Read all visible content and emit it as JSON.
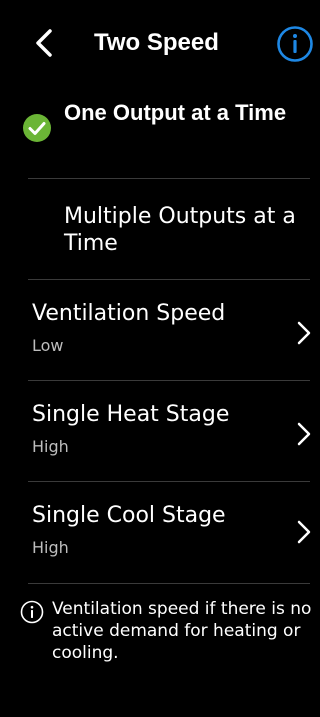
{
  "header": {
    "title": "Two Speed",
    "back_icon": "chevron-left-icon",
    "info_icon": "info-icon"
  },
  "options": [
    {
      "label": "One Output at a Time",
      "selected": true
    },
    {
      "label": "Multiple Outputs at a Time",
      "selected": false
    }
  ],
  "settings": [
    {
      "title": "Ventilation Speed",
      "value": "Low"
    },
    {
      "title": "Single Heat Stage",
      "value": "High"
    },
    {
      "title": "Single Cool Stage",
      "value": "High"
    }
  ],
  "note": {
    "text": "Ventilation speed if there is no active demand for heating or cooling.",
    "icon": "info-circle-icon"
  },
  "colors": {
    "background": "#000000",
    "accent_blue": "#1E88E5",
    "check_green": "#6BB536",
    "divider": "#3A3A3A",
    "secondary_text": "#BDBDBD"
  }
}
